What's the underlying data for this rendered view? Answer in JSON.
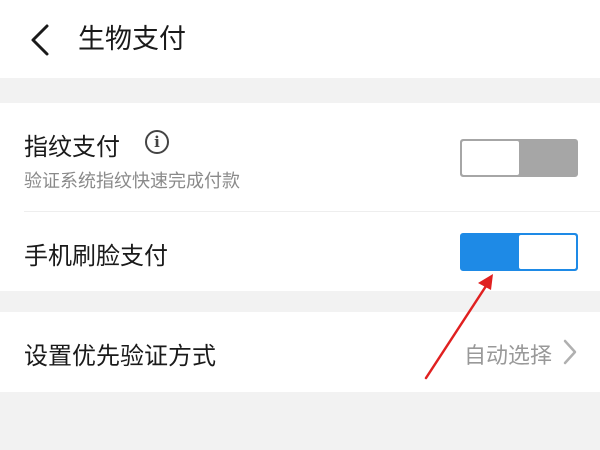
{
  "header": {
    "back_icon": "chevron-left-icon",
    "title": "生物支付"
  },
  "settings": {
    "fingerprint": {
      "label": "指纹支付",
      "info_icon": "info-icon",
      "info_glyph": "i",
      "description": "验证系统指纹快速完成付款",
      "enabled": false
    },
    "face": {
      "label": "手机刷脸支付",
      "enabled": true
    },
    "priority": {
      "label": "设置优先验证方式",
      "value": "自动选择",
      "chevron_icon": "chevron-right-icon"
    }
  },
  "colors": {
    "toggle_on": "#1e8ae6",
    "toggle_off": "#a6a6a6",
    "annotation_arrow": "#e02020"
  }
}
